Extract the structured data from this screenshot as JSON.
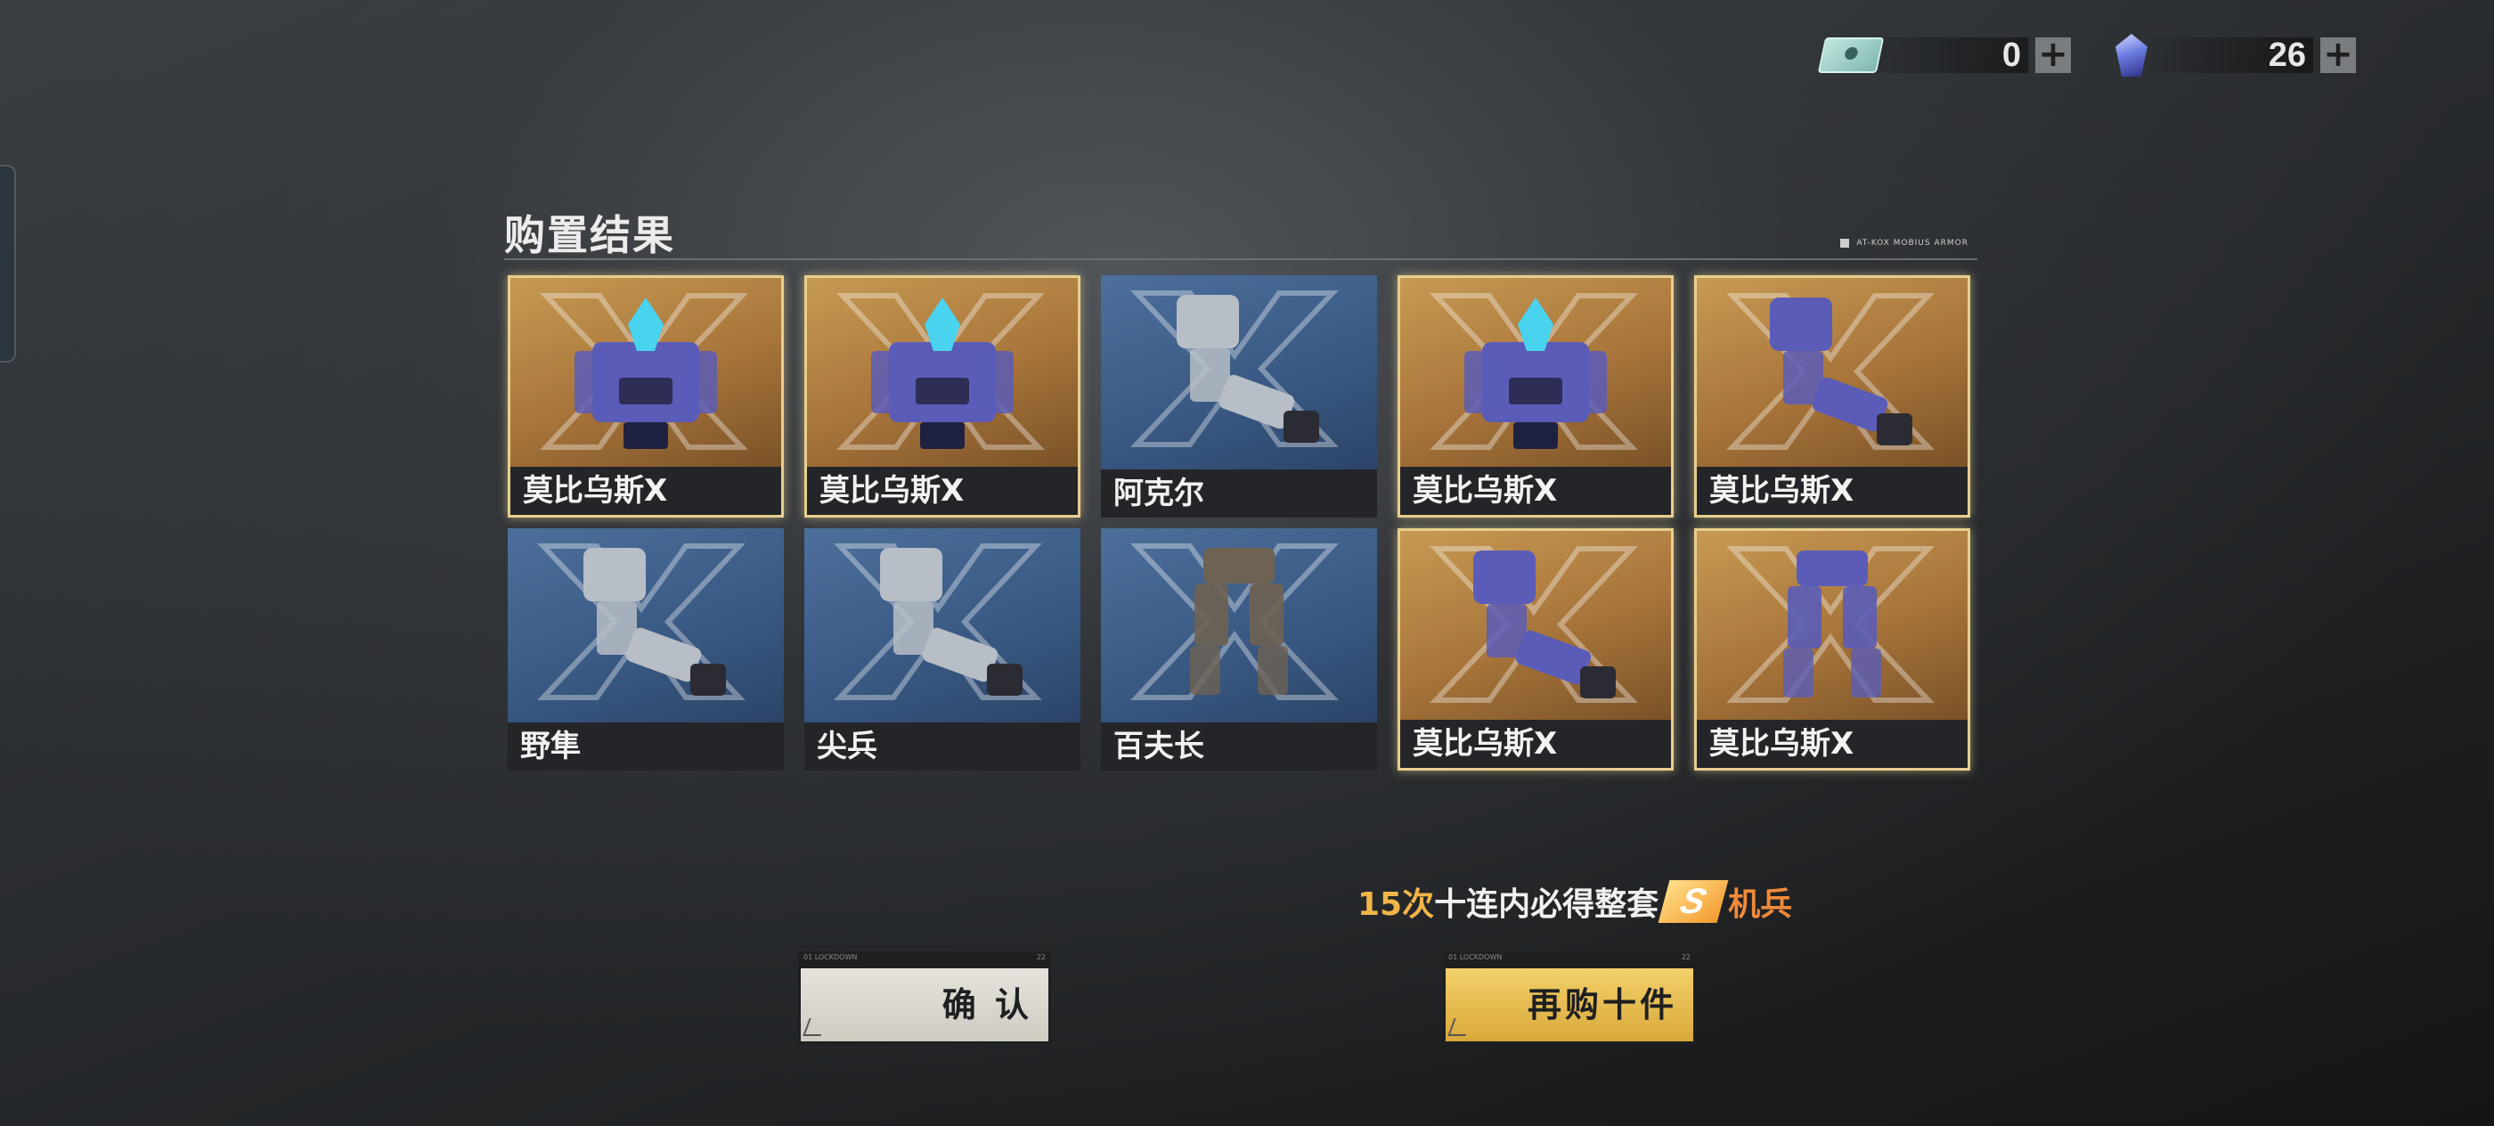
{
  "currency": {
    "ticket": {
      "icon": "ticket-icon",
      "value": "0",
      "add": "+"
    },
    "gem": {
      "icon": "gem-icon",
      "value": "26",
      "add": "+"
    }
  },
  "title": "购置结果",
  "title_note": "AT-KOX MOBIUS ARMOR",
  "results": [
    {
      "name": "莫比乌斯X",
      "rarity": "gold",
      "part": "torso"
    },
    {
      "name": "莫比乌斯X",
      "rarity": "gold",
      "part": "torso"
    },
    {
      "name": "阿克尔",
      "rarity": "blue",
      "part": "arm"
    },
    {
      "name": "莫比乌斯X",
      "rarity": "gold",
      "part": "torso"
    },
    {
      "name": "莫比乌斯X",
      "rarity": "gold",
      "part": "arm"
    },
    {
      "name": "野隼",
      "rarity": "blue",
      "part": "arm"
    },
    {
      "name": "尖兵",
      "rarity": "blue",
      "part": "arm"
    },
    {
      "name": "百夫长",
      "rarity": "blue",
      "part": "legs"
    },
    {
      "name": "莫比乌斯X",
      "rarity": "gold",
      "part": "arm"
    },
    {
      "name": "莫比乌斯X",
      "rarity": "gold",
      "part": "legs"
    }
  ],
  "pity": {
    "count": "15次",
    "middle": "十连内必得整套",
    "badge": "S",
    "suffix": "机兵"
  },
  "buttons": {
    "confirm": {
      "label": "确 认",
      "tag_left": "01 LOCKDOWN",
      "tag_right": "22"
    },
    "again": {
      "label": "再购十件",
      "tag_left": "01 LOCKDOWN",
      "tag_right": "22"
    }
  },
  "colors": {
    "gold_frame": "#e8cf8f",
    "gold_bg": "#b3813f",
    "blue_bg": "#3e5f8b",
    "accent_orange": "#f2b54a"
  }
}
